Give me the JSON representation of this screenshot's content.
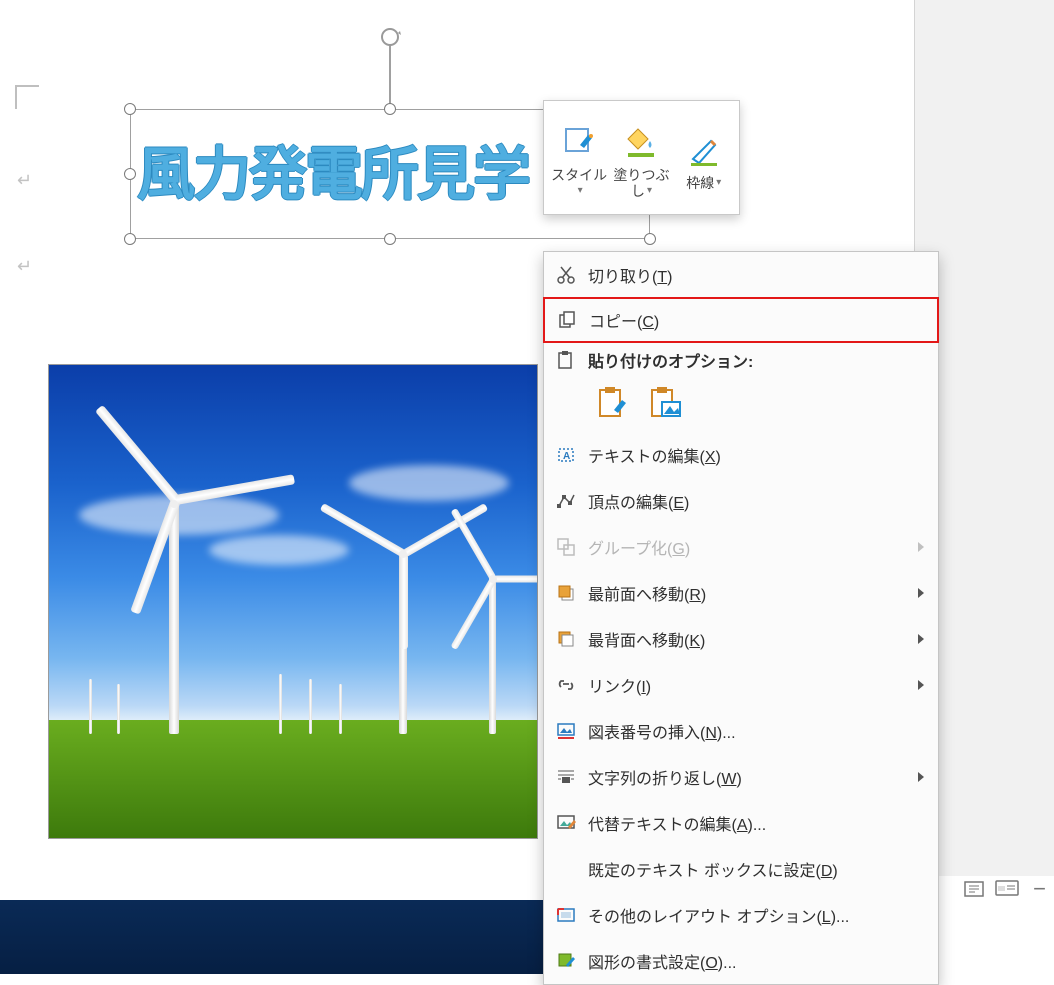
{
  "colors": {
    "accent": "#4faee0",
    "highlight": "#e31818"
  },
  "document": {
    "wordart_text": "風力発電所見学"
  },
  "mini_toolbar": {
    "items": [
      {
        "id": "style",
        "label": "スタイル",
        "has_dropdown": true
      },
      {
        "id": "fill",
        "label": "塗りつぶし",
        "has_dropdown": true
      },
      {
        "id": "outline",
        "label": "枠線",
        "has_dropdown": true
      }
    ]
  },
  "context_menu": {
    "highlighted": "copy",
    "items": [
      {
        "id": "cut",
        "text": "切り取り",
        "key": "T"
      },
      {
        "id": "copy",
        "text": "コピー",
        "key": "C"
      },
      {
        "id": "paste_header",
        "text": "貼り付けのオプション:",
        "header": true
      },
      {
        "id": "paste_options",
        "options": [
          {
            "id": "paste-keep-format",
            "name": "paste-keep-format-icon"
          },
          {
            "id": "paste-picture",
            "name": "paste-picture-icon"
          }
        ]
      },
      {
        "id": "edit_text",
        "text": "テキストの編集",
        "key": "X"
      },
      {
        "id": "edit_points",
        "text": "頂点の編集",
        "key": "E"
      },
      {
        "id": "group",
        "text": "グループ化",
        "key": "G",
        "disabled": true,
        "submenu": true
      },
      {
        "id": "bring_front",
        "text": "最前面へ移動",
        "key": "R",
        "submenu": true
      },
      {
        "id": "send_back",
        "text": "最背面へ移動",
        "key": "K",
        "submenu": true
      },
      {
        "id": "link",
        "text": "リンク",
        "key": "I",
        "submenu": true
      },
      {
        "id": "caption",
        "text": "図表番号の挿入",
        "key": "N",
        "ellipsis": true
      },
      {
        "id": "wrap",
        "text": "文字列の折り返し",
        "key": "W",
        "submenu": true
      },
      {
        "id": "alt_text",
        "text": "代替テキストの編集",
        "key": "A",
        "ellipsis": true
      },
      {
        "id": "default_tb",
        "text": "既定のテキスト ボックスに設定",
        "key": "D"
      },
      {
        "id": "more_layout",
        "text": "その他のレイアウト オプション",
        "key": "L",
        "ellipsis": true
      },
      {
        "id": "format_shape",
        "text": "図形の書式設定",
        "key": "O",
        "ellipsis": true
      }
    ]
  },
  "status_bar": {
    "minus_label": "−"
  }
}
